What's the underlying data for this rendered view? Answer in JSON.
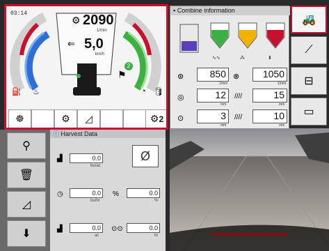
{
  "engine": {
    "clock": "03:14",
    "rpm_value": "2090",
    "rpm_unit": "1/min",
    "speed_value": "5,0",
    "speed_unit": "km/h",
    "gear_badge": "2",
    "bottom_buttons": [
      "steering-wheel-icon",
      "empty-slot",
      "settings-gear-icon",
      "ramp-icon",
      "empty-slot",
      "empty-slot",
      "gear-2-icon"
    ],
    "gear2_label": "2"
  },
  "combine": {
    "title": "Combine information",
    "rows": [
      {
        "left_value": "850",
        "left_unit": "1/min",
        "right_value": "1050",
        "right_unit": "1/min"
      },
      {
        "left_value": "12",
        "left_unit": "mm",
        "right_value": "15",
        "right_unit": "mm"
      },
      {
        "left_value": "3",
        "left_unit": "mm",
        "right_value": "10",
        "right_unit": "mm"
      }
    ],
    "level_colors": [
      "#3cb043",
      "#f0b400",
      "#c8102e"
    ]
  },
  "right_tabs": [
    "combine-icon",
    "field-icon",
    "bin-unload-icon",
    "monitor-icon"
  ],
  "harvest": {
    "title": "Harvest Data",
    "rows": [
      {
        "value": "0.0",
        "unit": "bu/ac"
      },
      {
        "value": "0.0",
        "unit": "bu/hr"
      },
      {
        "value": "0.0",
        "unit": "%"
      },
      {
        "value": "0.0",
        "unit": "ac"
      },
      {
        "value": "0.0",
        "unit": "hr"
      }
    ],
    "reset_glyph": "Ø"
  },
  "left_tabs": [
    "crop-gauge-icon",
    "bin-icon",
    "header-icon",
    "down-arrow-icon"
  ],
  "colors": {
    "accent": "#c8102e",
    "green": "#3cb043",
    "blue": "#2e6fd6"
  }
}
